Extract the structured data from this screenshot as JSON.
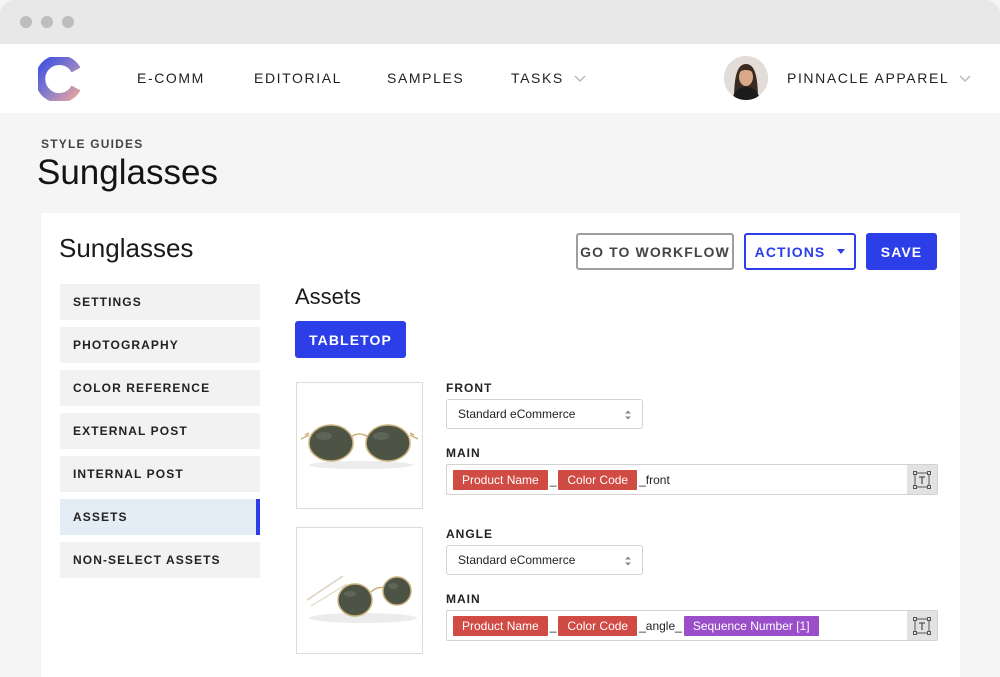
{
  "nav": {
    "items": [
      "E-COMM",
      "EDITORIAL",
      "SAMPLES",
      "TASKS"
    ],
    "account": "PINNACLE APPAREL"
  },
  "header": {
    "breadcrumb": "STYLE GUIDES",
    "title": "Sunglasses"
  },
  "card": {
    "title": "Sunglasses",
    "buttons": {
      "workflow": "GO TO WORKFLOW",
      "actions": "ACTIONS",
      "save": "SAVE"
    }
  },
  "sidebar": {
    "items": [
      "SETTINGS",
      "PHOTOGRAPHY",
      "COLOR REFERENCE",
      "EXTERNAL POST",
      "INTERNAL POST",
      "ASSETS",
      "NON-SELECT ASSETS"
    ],
    "active": "ASSETS"
  },
  "assets": {
    "title": "Assets",
    "tab": "TABLETOP",
    "shots": [
      {
        "label": "FRONT",
        "preset": "Standard eCommerce",
        "naming_label": "MAIN",
        "tokens": [
          "Product Name",
          "_",
          "Color Code",
          "_front"
        ]
      },
      {
        "label": "ANGLE",
        "preset": "Standard eCommerce",
        "naming_label": "MAIN",
        "tokens": [
          "Product Name",
          "_",
          "Color Code",
          "_angle_",
          "Sequence Number [1]"
        ]
      }
    ]
  },
  "colors": {
    "accent": "#2b3ee8",
    "token_red": "#d14b45",
    "token_purple": "#9a4ec9"
  },
  "icons": [
    "logo-icon",
    "chevron-down-icon",
    "select-updown-icon",
    "text-field-icon"
  ]
}
